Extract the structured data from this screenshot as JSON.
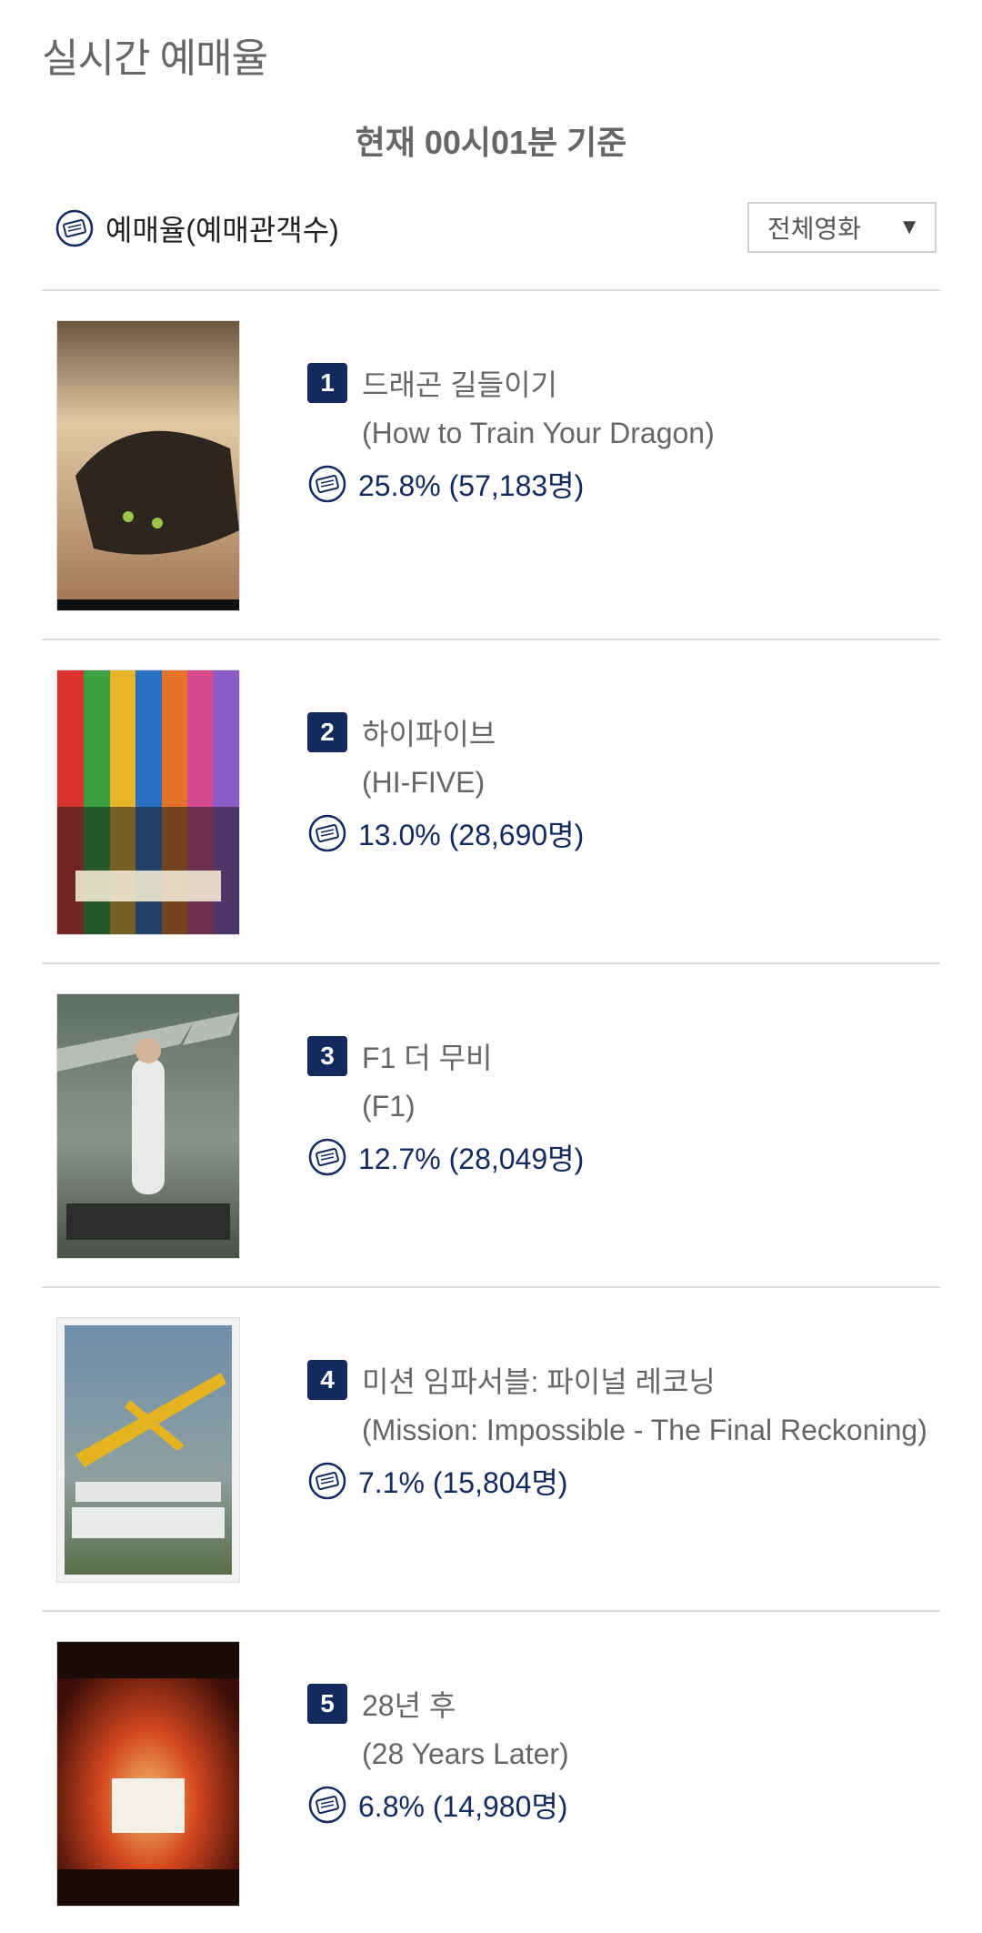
{
  "page_title": "실시간 예매율",
  "basis_text": "현재 00시01분 기준",
  "legend": {
    "icon": "ticket-icon",
    "label": "예매율(예매관객수)"
  },
  "filter": {
    "selected": "전체영화",
    "icon": "dropdown-triangle-icon"
  },
  "colors": {
    "rank_badge": "#142a5e",
    "rate_text": "#142a5e",
    "divider": "#d9d9d9"
  },
  "movies": [
    {
      "rank": "1",
      "title_ko": "드래곤 길들이기",
      "title_en": "(How to Train Your Dragon)",
      "rate": "25.8% (57,183명)"
    },
    {
      "rank": "2",
      "title_ko": "하이파이브",
      "title_en": "(HI-FIVE)",
      "rate": "13.0% (28,690명)"
    },
    {
      "rank": "3",
      "title_ko": "F1 더 무비",
      "title_en": "(F1)",
      "rate": "12.7% (28,049명)"
    },
    {
      "rank": "4",
      "title_ko": "미션 임파서블: 파이널 레코닝",
      "title_en": "(Mission: Impossible - The Final Reckoning)",
      "rate": "7.1% (15,804명)"
    },
    {
      "rank": "5",
      "title_ko": "28년 후",
      "title_en": "(28 Years Later)",
      "rate": "6.8% (14,980명)"
    }
  ]
}
